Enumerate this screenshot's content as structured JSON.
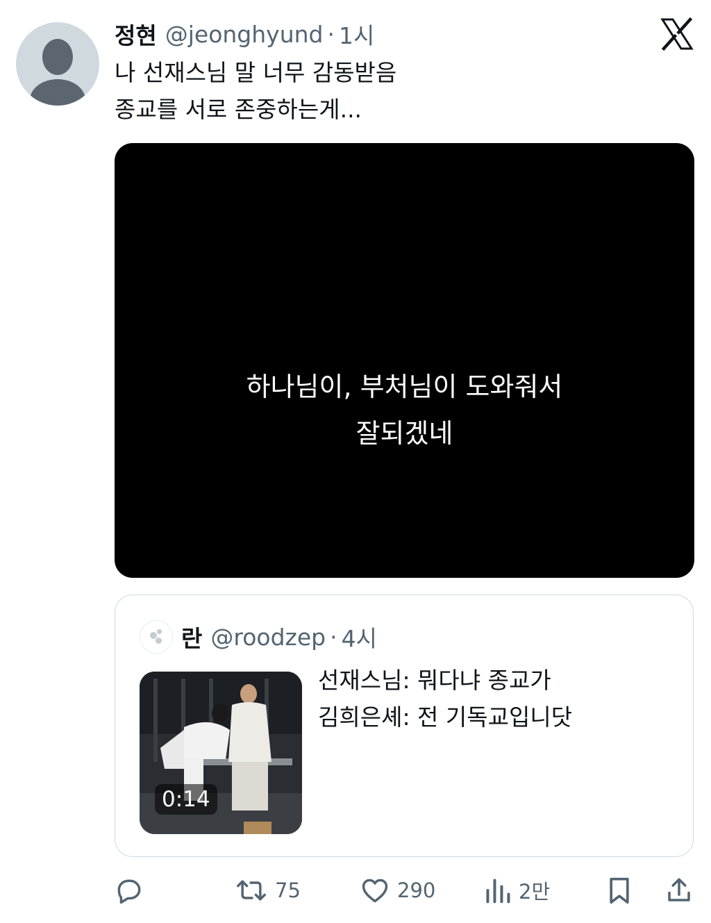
{
  "tweet": {
    "author_name": "정현",
    "author_handle": "@jeonghyund",
    "separator": "·",
    "time": "1시",
    "text": "나 선재스님 말 너무 감동받음\n종교를 서로 존중하는게...",
    "video_caption_line1": "하나님이, 부처님이 도와줘서",
    "video_caption_line2": "잘되겠네"
  },
  "quote": {
    "author_name": "란",
    "author_handle": "@roodzep",
    "separator": "·",
    "time": "4시",
    "text": "선재스님: 뭐다냐 종교가\n김희은셰: 전 기독교입니닷",
    "video_duration": "0:14"
  },
  "actions": {
    "reply_icon": "reply-icon",
    "retweet_count": "75",
    "like_count": "290",
    "views_count": "2만",
    "bookmark_icon": "bookmark-icon",
    "share_icon": "share-icon"
  }
}
